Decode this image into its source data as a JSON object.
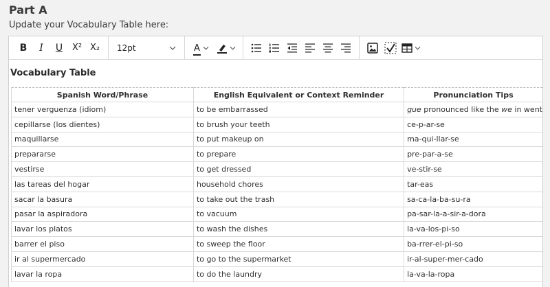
{
  "header": {
    "part_title": "Part A",
    "instructions": "Update your Vocabulary Table here:"
  },
  "toolbar": {
    "bold": "B",
    "italic": "I",
    "underline": "U",
    "superscript": "X²",
    "subscript": "X₂",
    "font_size": "12pt",
    "font_color_glyph": "A"
  },
  "document": {
    "heading": "Vocabulary Table",
    "columns": [
      "Spanish Word/Phrase",
      "English Equivalent or Context Reminder",
      "Pronunciation Tips"
    ],
    "first_tip": {
      "em1": "gue",
      "mid": " pronounced like the ",
      "em2": "we",
      "end": " in went"
    },
    "rows": [
      [
        "tener verguenza (idiom)",
        "to be embarrassed",
        "gue pronounced like the we in went"
      ],
      [
        "cepillarse (los dientes)",
        "to brush your teeth",
        "ce-p-ar-se"
      ],
      [
        "maquillarse",
        "to put makeup on",
        "ma-qui-llar-se"
      ],
      [
        "prepararse",
        "to prepare",
        "pre-par-a-se"
      ],
      [
        "vestirse",
        "to get dressed",
        "ve-stir-se"
      ],
      [
        "las tareas del hogar",
        "household chores",
        "tar-eas"
      ],
      [
        "sacar la basura",
        "to take out the trash",
        "sa-ca-la-ba-su-ra"
      ],
      [
        "pasar la aspiradora",
        "to vacuum",
        "pa-sar-la-a-sir-a-dora"
      ],
      [
        "lavar los platos",
        "to wash the dishes",
        "la-va-los-pi-so"
      ],
      [
        "barrer el piso",
        "to sweep the floor",
        "ba-rrer-el-pi-so"
      ],
      [
        "ir al supermercado",
        "to go to the supermarket",
        "ir-al-super-mer-cado"
      ],
      [
        "lavar la ropa",
        "to do the laundry",
        "la-va-la-ropa"
      ]
    ]
  },
  "colors": {
    "background": "#f2f2f3",
    "editor_border": "#cfcfcf",
    "grid": "#d8d8d8"
  },
  "icons": [
    "chevron-down-icon",
    "highlighter-icon",
    "bullet-list-icon",
    "numbered-list-icon",
    "outdent-icon",
    "align-left-icon",
    "align-center-icon",
    "align-right-icon",
    "image-icon",
    "spellcheck-icon",
    "table-icon"
  ]
}
